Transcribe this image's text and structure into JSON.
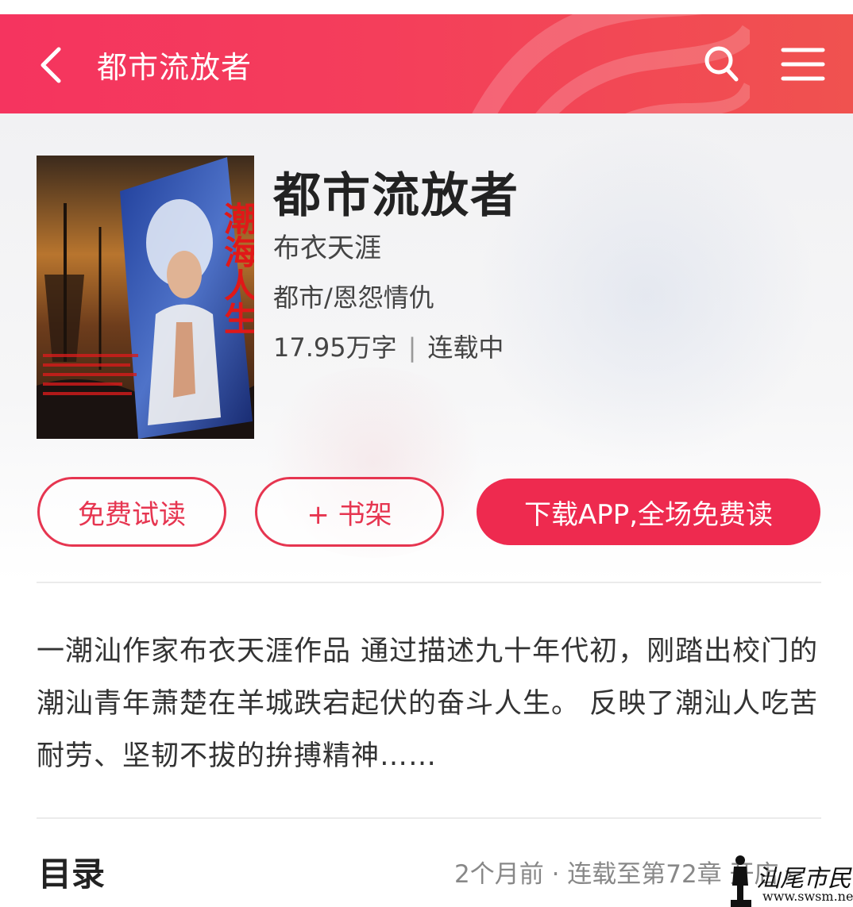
{
  "header": {
    "title": "都市流放者",
    "back_icon": "chevron-left-icon",
    "search_icon": "search-icon",
    "menu_icon": "hamburger-menu-icon"
  },
  "book": {
    "title": "都市流放者",
    "author": "布衣天涯",
    "category": "都市/恩怨情仇",
    "word_count": "17.95万字",
    "separator": "|",
    "status": "连载中",
    "cover": {
      "title_text": "潮海人生"
    }
  },
  "actions": {
    "free_read_label": "免费试读",
    "add_shelf_label": "+ 书架",
    "download_label": "下载APP,全场免费读"
  },
  "description": "一潮汕作家布衣天涯作品 通过描述九十年代初，刚踏出校门的潮汕青年萧楚在羊城跌宕起伏的奋斗人生。 反映了潮汕人吃苦耐劳、坚韧不拔的拚搏精神……",
  "toc": {
    "title": "目录",
    "status": "2个月前 · 连载至第72章 开店",
    "chevron": "›"
  },
  "watermark": {
    "text": "汕尾市民网",
    "url": "www.swsm.net"
  },
  "colors": {
    "accent": "#ee2a4f",
    "header_start": "#f5345f",
    "header_end": "#f0524f"
  }
}
